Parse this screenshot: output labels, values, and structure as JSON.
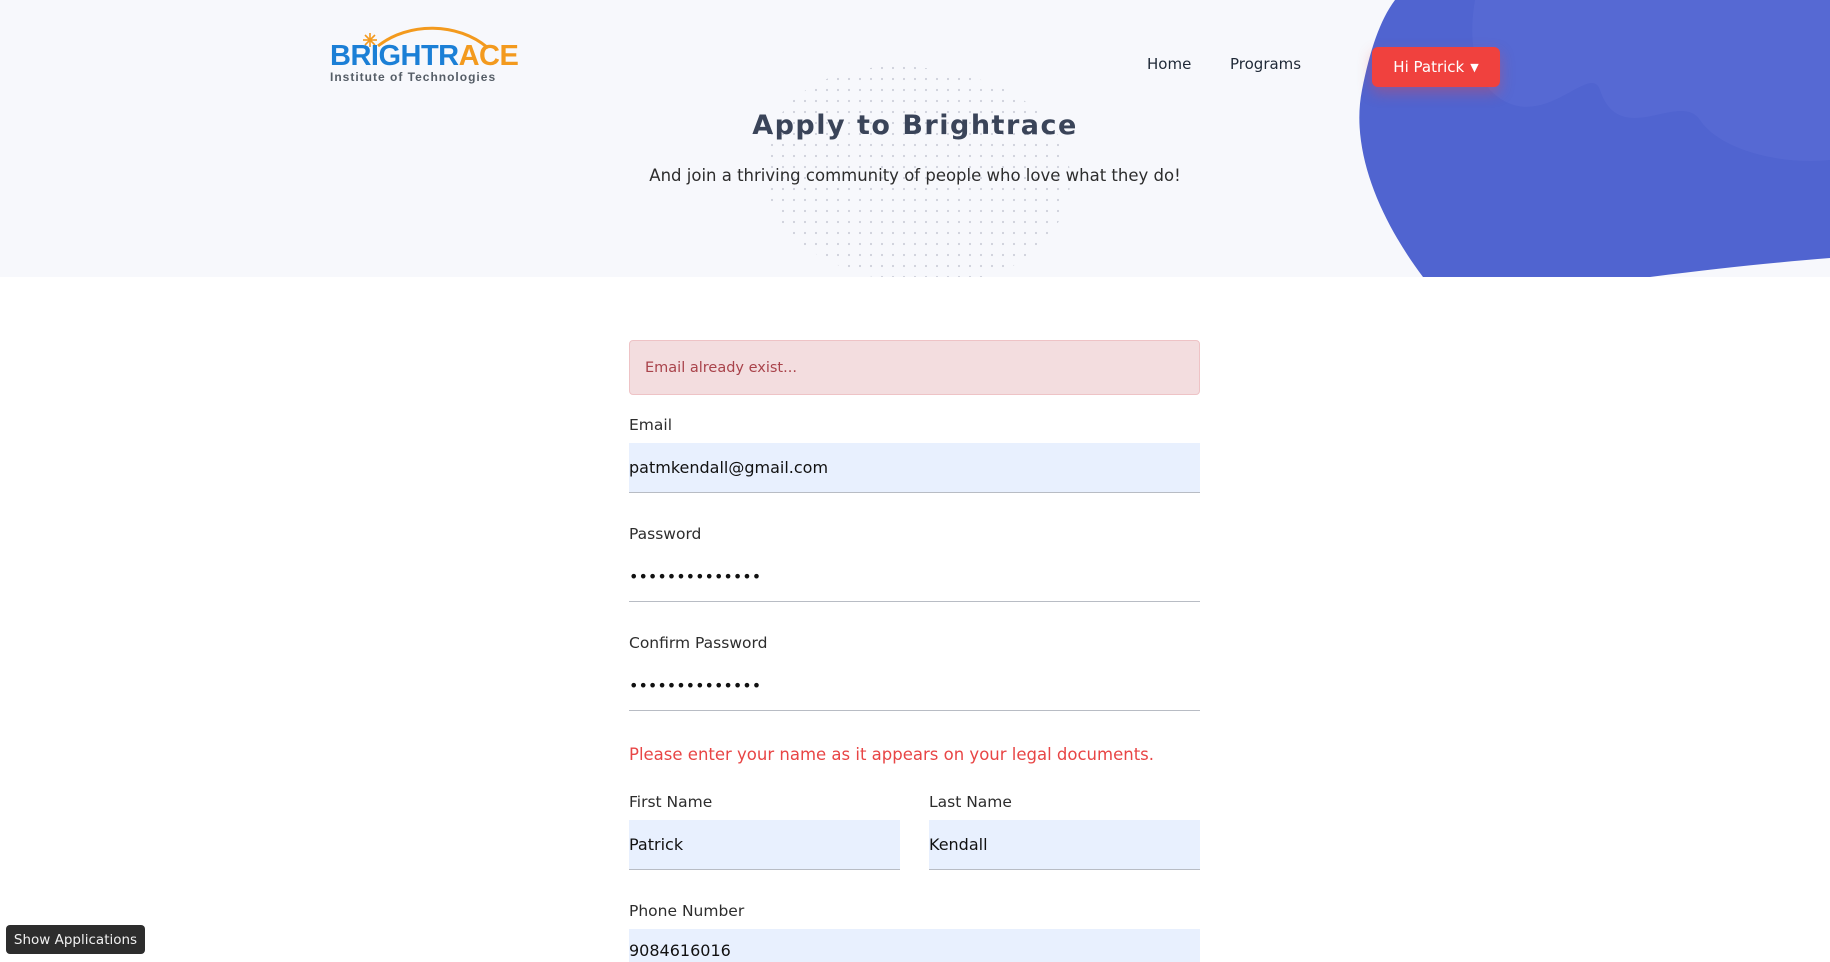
{
  "brand": {
    "logo_part1": "BRIGHTR",
    "logo_part2": "ACE",
    "tagline": "Institute of Technologies"
  },
  "nav": {
    "home": "Home",
    "programs": "Programs",
    "user_button": "Hi Patrick",
    "user_caret": "▼"
  },
  "hero": {
    "title": "Apply to Brightrace",
    "subtitle": "And join a thriving community of people who love what they do!"
  },
  "alert": {
    "message": "Email already exist..."
  },
  "form": {
    "email_label": "Email",
    "email_value": "patmkendall@gmail.com",
    "password_label": "Password",
    "password_value": "••••••••••••••",
    "confirm_label": "Confirm Password",
    "confirm_value": "••••••••••••••",
    "legal_note": "Please enter your name as it appears on your legal documents.",
    "first_name_label": "First Name",
    "first_name_value": "Patrick",
    "last_name_label": "Last Name",
    "last_name_value": "Kendall",
    "phone_label": "Phone Number",
    "phone_value": "9084616016"
  },
  "footer": {
    "show_apps": "Show Applications"
  },
  "colors": {
    "accent_red": "#f0413e",
    "blob_blue": "#5064d0",
    "logo_blue": "#1b7fd6",
    "logo_orange": "#f39a1e",
    "error_text": "#e84545",
    "autofill_bg": "#e8f0fe"
  }
}
